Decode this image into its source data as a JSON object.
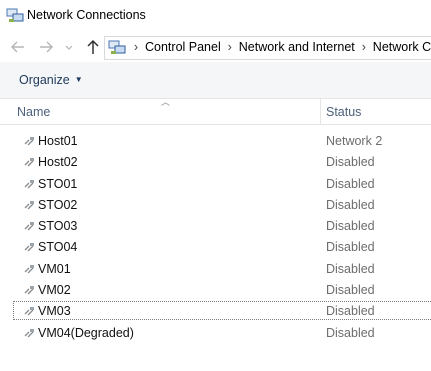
{
  "window": {
    "title": "Network Connections",
    "icon": "network-connections-icon"
  },
  "nav": {
    "back_icon": "back-arrow-icon",
    "forward_icon": "forward-arrow-icon",
    "recent_icon": "chevron-down-icon",
    "up_icon": "up-arrow-icon",
    "breadcrumb": [
      "Control Panel",
      "Network and Internet",
      "Network Co"
    ]
  },
  "toolbar": {
    "organize_label": "Organize"
  },
  "columns": {
    "name": "Name",
    "status": "Status"
  },
  "connections": [
    {
      "name": "Host01",
      "status": "Network  2"
    },
    {
      "name": "Host02",
      "status": "Disabled"
    },
    {
      "name": "STO01",
      "status": "Disabled"
    },
    {
      "name": "STO02",
      "status": "Disabled"
    },
    {
      "name": "STO03",
      "status": "Disabled"
    },
    {
      "name": "STO04",
      "status": "Disabled"
    },
    {
      "name": "VM01",
      "status": "Disabled"
    },
    {
      "name": "VM02",
      "status": "Disabled"
    },
    {
      "name": "VM03",
      "status": "Disabled",
      "selected": true
    },
    {
      "name": "VM04(Degraded)",
      "status": "Disabled"
    }
  ],
  "colors": {
    "header_text": "#4c607a",
    "status_text": "#6d6d6d",
    "command_bar": "#f5f6f7"
  }
}
